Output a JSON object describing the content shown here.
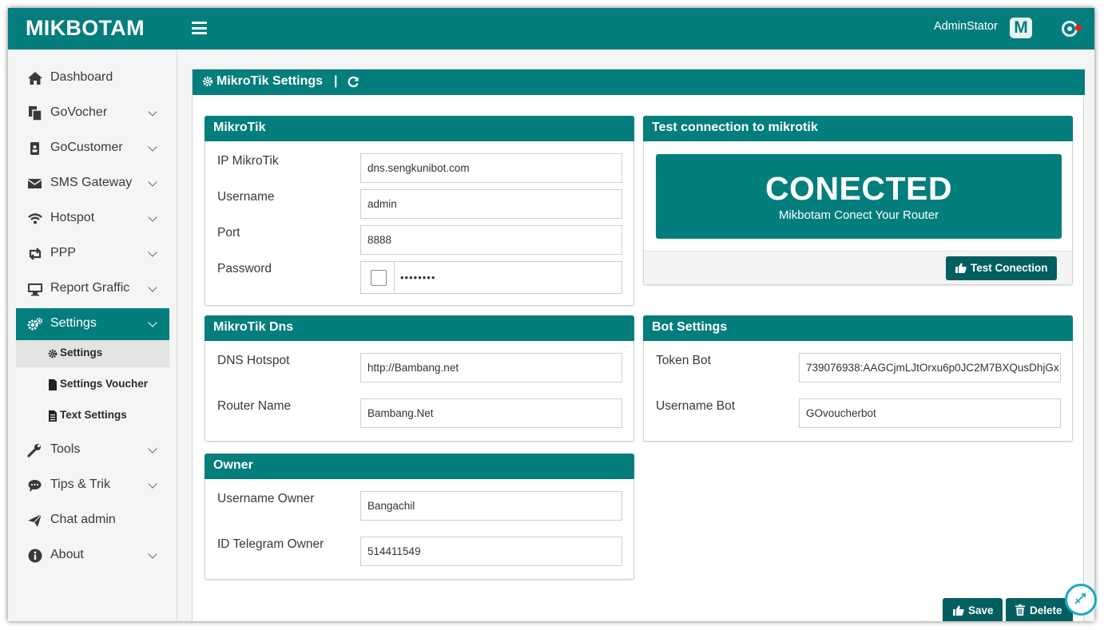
{
  "app": {
    "brand": "MIKBOTAM",
    "user": "AdminStator",
    "user_logo": "M"
  },
  "sidebar": {
    "items": [
      {
        "label": "Dashboard",
        "icon": "home-icon"
      },
      {
        "label": "GoVocher",
        "icon": "copy-icon"
      },
      {
        "label": "GoCustomer",
        "icon": "badge-icon"
      },
      {
        "label": "SMS Gateway",
        "icon": "envelope-icon"
      },
      {
        "label": "Hotspot",
        "icon": "wifi-icon"
      },
      {
        "label": "PPP",
        "icon": "retweet-icon"
      },
      {
        "label": "Report Graffic",
        "icon": "desktop-icon"
      },
      {
        "label": "Settings",
        "icon": "gears-icon"
      },
      {
        "label": "Tools",
        "icon": "wrench-icon"
      },
      {
        "label": "Tips & Trik",
        "icon": "comment-icon"
      },
      {
        "label": "Chat admin",
        "icon": "paper-plane-icon"
      },
      {
        "label": "About",
        "icon": "info-circle-icon"
      }
    ],
    "subitems": [
      {
        "label": "Settings",
        "icon": "gear-icon"
      },
      {
        "label": "Settings Voucher",
        "icon": "file-icon"
      },
      {
        "label": "Text Settings",
        "icon": "file-text-icon"
      }
    ]
  },
  "main": {
    "title": "MikroTik Settings",
    "separator": "|"
  },
  "mikrotik": {
    "title": "MikroTik",
    "ip_label": "IP MikroTik",
    "ip_value": "dns.sengkunibot.com",
    "username_label": "Username",
    "username_value": "admin",
    "port_label": "Port",
    "port_value": "8888",
    "password_label": "Password",
    "password_value": "••••••••"
  },
  "test": {
    "title": "Test connection to mikrotik",
    "status": "CONECTED",
    "subtitle": "Mikbotam Conect Your Router",
    "button": "Test Conection"
  },
  "dns": {
    "title": "MikroTik Dns",
    "hotspot_label": "DNS Hotspot",
    "hotspot_value": "http://Bambang.net",
    "router_label": "Router Name",
    "router_value": "Bambang.Net"
  },
  "bot": {
    "title": "Bot Settings",
    "token_label": "Token Bot",
    "token_value": "739076938:AAGCjmLJtOrxu6p0JC2M7BXQusDhjGx",
    "username_label": "Username Bot",
    "username_value": "GOvoucherbot"
  },
  "owner": {
    "title": "Owner",
    "username_label": "Username Owner",
    "username_value": "Bangachil",
    "telegram_label": "ID Telegram Owner",
    "telegram_value": "514411549"
  },
  "actions": {
    "save": "Save",
    "delete": "Delete"
  },
  "colors": {
    "accent": "#047d7d",
    "button": "#035f5f",
    "notification": "#e02020",
    "chat": "#19a9c6"
  }
}
